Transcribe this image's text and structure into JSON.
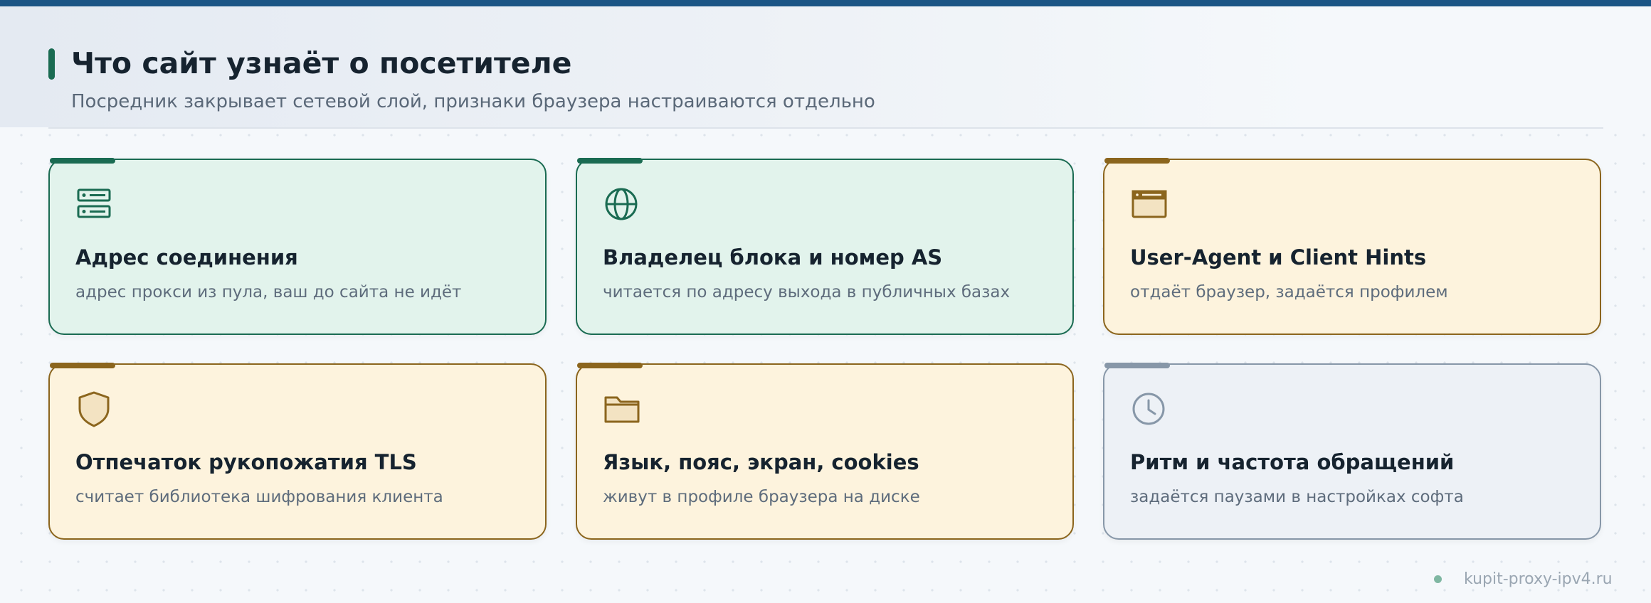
{
  "header": {
    "title": "Что сайт узнаёт о посетителе",
    "subtitle": "Посредник закрывает сетевой слой, признаки браузера настраиваются отдельно"
  },
  "colors": {
    "top_bar": "#1b5585",
    "green_accent": "#1a6b52",
    "green_bg": "#e2f3ec",
    "yellow_accent": "#8b651d",
    "yellow_bg": "#fdf3dd",
    "gray_accent": "#8797a8",
    "gray_bg": "#edf1f6"
  },
  "cards": [
    {
      "icon": "server-icon",
      "variant": "green",
      "title": "Адрес соединения",
      "description": "адрес прокси из пула, ваш до сайта не идёт"
    },
    {
      "icon": "globe-icon",
      "variant": "green",
      "title": "Владелец блока и номер AS",
      "description": "читается по адресу выхода в публичных базах"
    },
    {
      "icon": "browser-window-icon",
      "variant": "yellow",
      "title": "User-Agent и Client Hints",
      "description": "отдаёт браузер, задаётся профилем"
    },
    {
      "icon": "shield-icon",
      "variant": "yellow",
      "title": "Отпечаток рукопожатия TLS",
      "description": "считает библиотека шифрования клиента"
    },
    {
      "icon": "folder-icon",
      "variant": "yellow",
      "title": "Язык, пояс, экран, cookies",
      "description": "живут в профиле браузера на диске"
    },
    {
      "icon": "clock-icon",
      "variant": "gray",
      "title": "Ритм и частота обращений",
      "description": "задаётся паузами в настройках софта"
    }
  ],
  "footer": {
    "site": "kupit-proxy-ipv4.ru"
  }
}
